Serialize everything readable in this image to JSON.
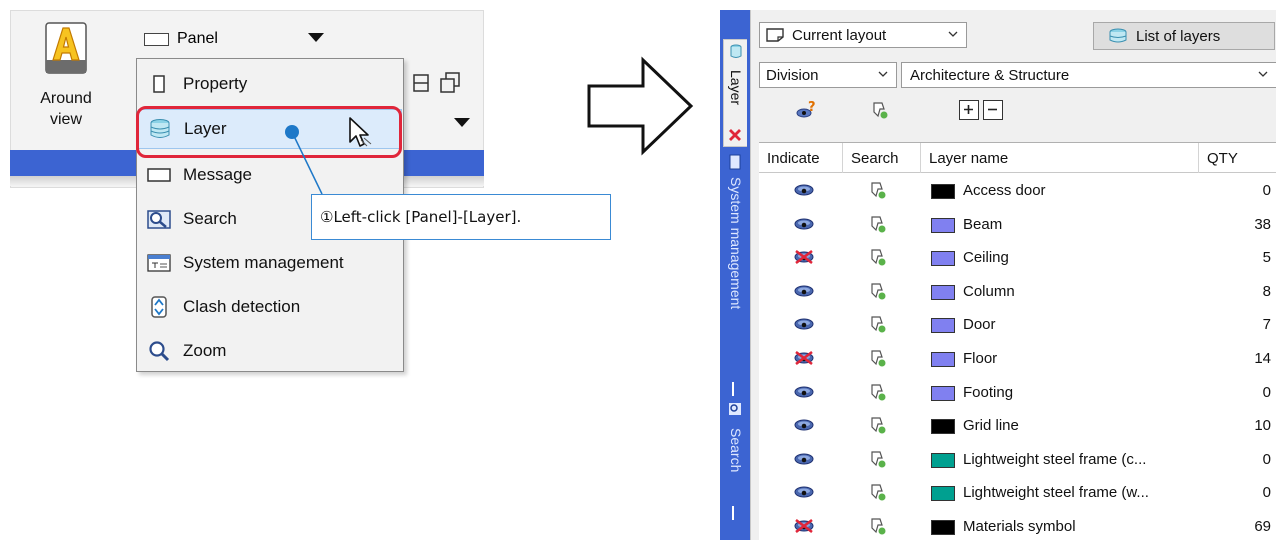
{
  "ribbon": {
    "around_view_label": "Around view",
    "panel_label": "Panel",
    "accent": "#3c64d2"
  },
  "panel_menu": {
    "items": [
      {
        "label": "Property",
        "icon": "property-icon"
      },
      {
        "label": "Layer",
        "icon": "layer-stack-icon",
        "highlighted": true
      },
      {
        "label": "Message",
        "icon": "message-icon"
      },
      {
        "label": "Search",
        "icon": "search-panel-icon"
      },
      {
        "label": "System management",
        "icon": "system-management-icon"
      },
      {
        "label": "Clash detection",
        "icon": "clash-detection-icon"
      },
      {
        "label": "Zoom",
        "icon": "zoom-icon"
      }
    ]
  },
  "callout": {
    "text": "①Left-click [Panel]-[Layer].",
    "highlight_color": "#e0263a",
    "line_color": "#1e78c8"
  },
  "layer_panel": {
    "side_tabs": {
      "layer": "Layer",
      "system_management": "System management",
      "search": "Search"
    },
    "layout_combo": "Current layout",
    "list_button": "List of layers",
    "division_combo": "Division",
    "category_combo": "Architecture & Structure",
    "columns": {
      "indicate": "Indicate",
      "search": "Search",
      "layer_name": "Layer name",
      "qty": "QTY"
    },
    "layers": [
      {
        "name": "Access door",
        "qty": "0",
        "visible": true,
        "color": "#000000"
      },
      {
        "name": "Beam",
        "qty": "38",
        "visible": true,
        "color": "#8080f0"
      },
      {
        "name": "Ceiling",
        "qty": "5",
        "visible": false,
        "color": "#8080f0"
      },
      {
        "name": "Column",
        "qty": "8",
        "visible": true,
        "color": "#8080f0"
      },
      {
        "name": "Door",
        "qty": "7",
        "visible": true,
        "color": "#8080f0"
      },
      {
        "name": "Floor",
        "qty": "14",
        "visible": false,
        "color": "#8080f0"
      },
      {
        "name": "Footing",
        "qty": "0",
        "visible": true,
        "color": "#8080f0"
      },
      {
        "name": "Grid line",
        "qty": "10",
        "visible": true,
        "color": "#000000"
      },
      {
        "name": "Lightweight steel frame (c...",
        "qty": "0",
        "visible": true,
        "color": "#00a090"
      },
      {
        "name": "Lightweight steel frame (w...",
        "qty": "0",
        "visible": true,
        "color": "#00a090"
      },
      {
        "name": "Materials symbol",
        "qty": "69",
        "visible": false,
        "color": "#000000"
      }
    ]
  }
}
